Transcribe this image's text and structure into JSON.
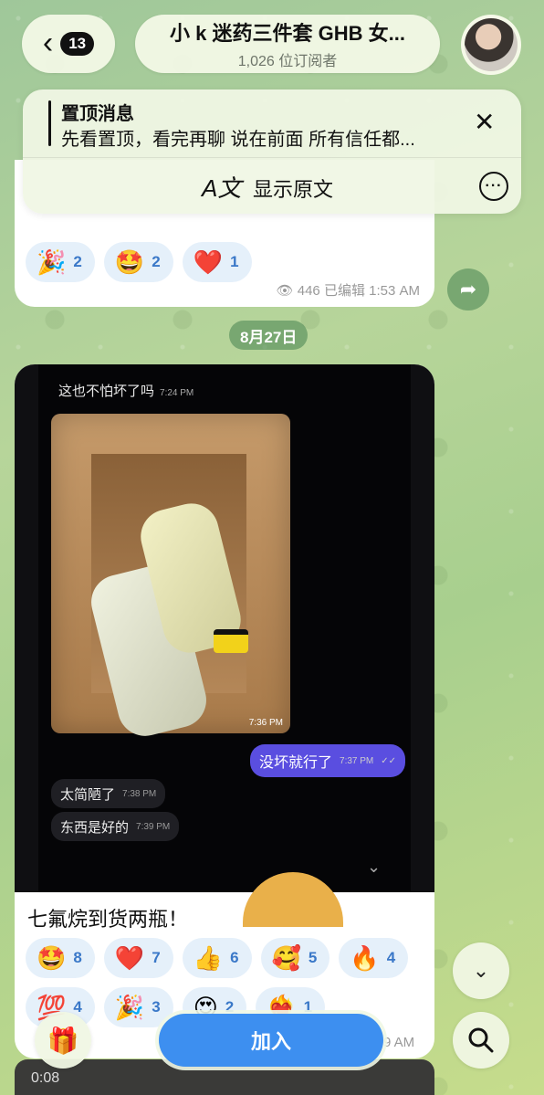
{
  "header": {
    "back_badge": "13",
    "title": "小 k 迷药三件套 GHB 女...",
    "subtitle": "1,026 位订阅者"
  },
  "pinned": {
    "title": "置顶消息",
    "text": "先看置顶，看完再聊 说在前面 所有信任都...",
    "translate_label": "显示原文"
  },
  "message1": {
    "reactions": [
      {
        "emoji": "🎉",
        "count": "2"
      },
      {
        "emoji": "🤩",
        "count": "2"
      },
      {
        "emoji": "❤️",
        "count": "1"
      }
    ],
    "views": "446",
    "edited": "已编辑",
    "time": "1:53 AM"
  },
  "date_separator": "8月27日",
  "message2": {
    "screenshot": {
      "line1_text": "这也不怕坏了吗",
      "line1_time": "7:24 PM",
      "photo_time": "7:36 PM",
      "out_text": "没坏就行了",
      "out_time": "7:37 PM",
      "in1_text": "太简陋了",
      "in1_time": "7:38 PM",
      "in2_text": "东西是好的",
      "in2_time": "7:39 PM"
    },
    "caption": "七氟烷到货两瓶！",
    "reactions_row1": [
      {
        "emoji": "🤩",
        "count": "8"
      },
      {
        "emoji": "❤️",
        "count": "7"
      },
      {
        "emoji": "👍",
        "count": "6"
      },
      {
        "emoji": "🥰",
        "count": "5"
      },
      {
        "emoji": "🔥",
        "count": "4"
      }
    ],
    "reactions_row2": [
      {
        "emoji": "💯",
        "count": "4"
      },
      {
        "emoji": "🎉",
        "count": "3"
      },
      {
        "emoji": "😍",
        "count": "2"
      },
      {
        "emoji": "❤️‍🔥",
        "count": "1"
      }
    ],
    "time_partial": "9 AM"
  },
  "bottom": {
    "join_label": "加入",
    "next_duration": "0:08"
  }
}
